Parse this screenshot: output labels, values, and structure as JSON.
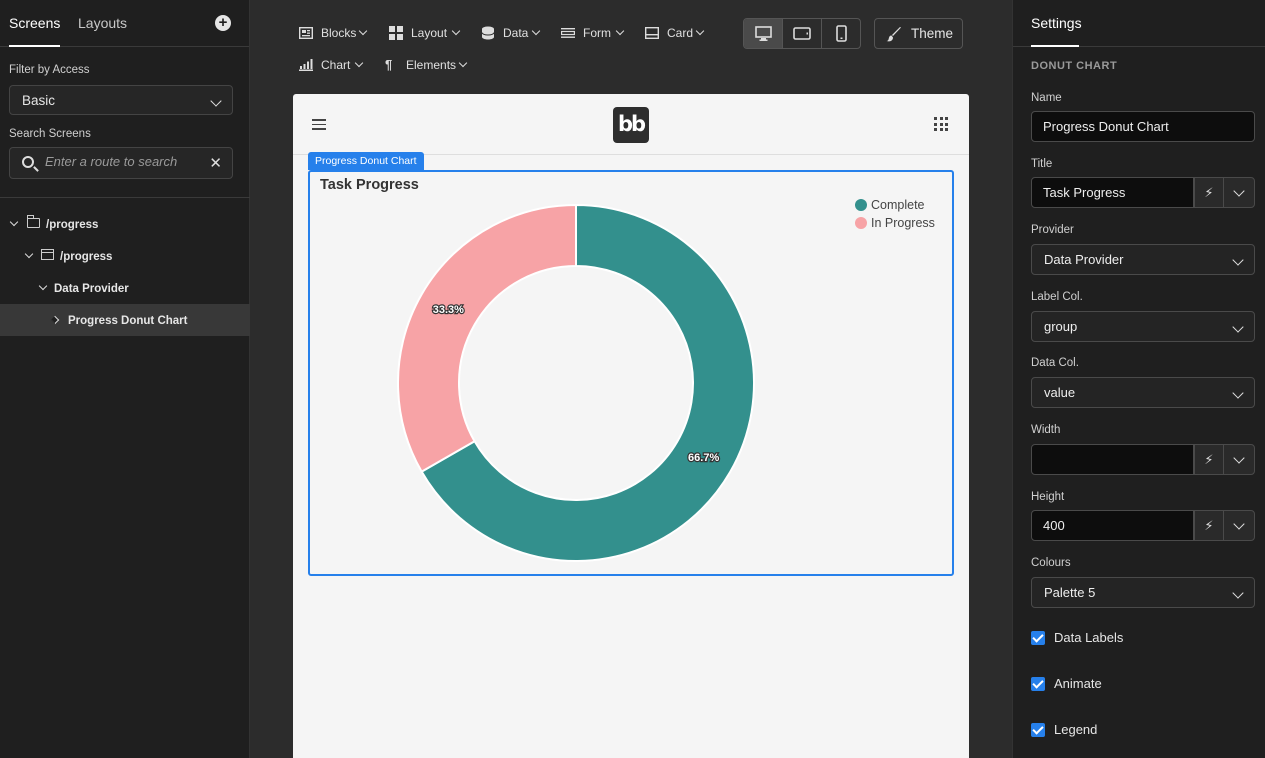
{
  "left_panel": {
    "tabs": [
      "Screens",
      "Layouts"
    ],
    "filter_label": "Filter by Access",
    "filter_value": "Basic",
    "search_label": "Search Screens",
    "search_placeholder": "Enter a route to search",
    "tree": [
      {
        "label": "/progress"
      },
      {
        "label": "/progress"
      },
      {
        "label": "Data Provider"
      },
      {
        "label": "Progress Donut Chart"
      }
    ]
  },
  "toolbar": {
    "items": [
      "Blocks",
      "Layout",
      "Data",
      "Form",
      "Card",
      "Chart",
      "Elements"
    ],
    "theme_label": "Theme"
  },
  "canvas": {
    "component_tag": "Progress Donut Chart",
    "logo_text": "bb"
  },
  "chart_data": {
    "type": "pie",
    "donut": true,
    "title": "Task Progress",
    "categories": [
      "Complete",
      "In Progress"
    ],
    "values": [
      66.7,
      33.3
    ],
    "labels": [
      "66.7%",
      "33.3%"
    ],
    "colors": [
      "#33908d",
      "#f7a3a6"
    ],
    "legend": "top-right"
  },
  "settings": {
    "tab": "Settings",
    "section": "DONUT CHART",
    "name_label": "Name",
    "name_value": "Progress Donut Chart",
    "title_label": "Title",
    "title_value": "Task Progress",
    "provider_label": "Provider",
    "provider_value": "Data Provider",
    "label_col_label": "Label Col.",
    "label_col_value": "group",
    "data_col_label": "Data Col.",
    "data_col_value": "value",
    "width_label": "Width",
    "width_value": "",
    "height_label": "Height",
    "height_value": "400",
    "colours_label": "Colours",
    "colours_value": "Palette 5",
    "checks": [
      "Data Labels",
      "Animate",
      "Legend"
    ]
  }
}
